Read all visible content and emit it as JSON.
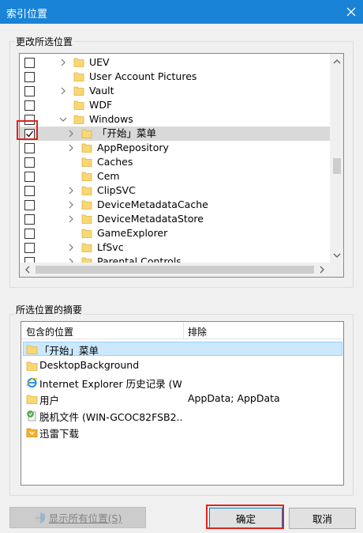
{
  "window": {
    "title": "索引位置"
  },
  "change_group": {
    "legend": "更改所选位置"
  },
  "tree": {
    "rows": [
      {
        "checked": false,
        "indent": 0,
        "expander": "right",
        "label": "UEV"
      },
      {
        "checked": false,
        "indent": 0,
        "expander": "none",
        "label": "User Account Pictures"
      },
      {
        "checked": false,
        "indent": 0,
        "expander": "right",
        "label": "Vault"
      },
      {
        "checked": false,
        "indent": 0,
        "expander": "none",
        "label": "WDF"
      },
      {
        "checked": false,
        "indent": 0,
        "expander": "down",
        "label": "Windows"
      },
      {
        "checked": true,
        "indent": 1,
        "expander": "right",
        "label": "「开始」菜单",
        "selected": true
      },
      {
        "checked": false,
        "indent": 1,
        "expander": "right",
        "label": "AppRepository"
      },
      {
        "checked": false,
        "indent": 1,
        "expander": "none",
        "label": "Caches"
      },
      {
        "checked": false,
        "indent": 1,
        "expander": "none",
        "label": "Cem"
      },
      {
        "checked": false,
        "indent": 1,
        "expander": "right",
        "label": "ClipSVC"
      },
      {
        "checked": false,
        "indent": 1,
        "expander": "right",
        "label": "DeviceMetadataCache"
      },
      {
        "checked": false,
        "indent": 1,
        "expander": "right",
        "label": "DeviceMetadataStore"
      },
      {
        "checked": false,
        "indent": 1,
        "expander": "none",
        "label": "GameExplorer"
      },
      {
        "checked": false,
        "indent": 1,
        "expander": "right",
        "label": "LfSvc"
      },
      {
        "checked": false,
        "indent": 1,
        "expander": "right",
        "label": "Parental Controls"
      }
    ]
  },
  "summary_group": {
    "legend": "所选位置的摘要"
  },
  "summary": {
    "columns": [
      "包含的位置",
      "排除"
    ],
    "rows": [
      {
        "icon": "folder-icon",
        "name": "「开始」菜单",
        "exclude": "",
        "selected": true
      },
      {
        "icon": "folder-icon",
        "name": "DesktopBackground",
        "exclude": ""
      },
      {
        "icon": "ie-icon",
        "name": "Internet Explorer 历史记录 (W...",
        "exclude": ""
      },
      {
        "icon": "folder-icon",
        "name": "用户",
        "exclude": "AppData; AppData"
      },
      {
        "icon": "offline-files-icon",
        "name": "脱机文件 (WIN-GCOC82FSB2...",
        "exclude": ""
      },
      {
        "icon": "xunlei-folder-icon",
        "name": "迅雷下载",
        "exclude": ""
      }
    ]
  },
  "buttons": {
    "show_all": "显示所有位置(S)",
    "ok": "确定",
    "cancel": "取消"
  },
  "colors": {
    "titlebar": "#1883d7",
    "highlight_red": "#e0231e",
    "folder_yellow": "#f8d775",
    "selection_blue": "#cce8ff"
  }
}
